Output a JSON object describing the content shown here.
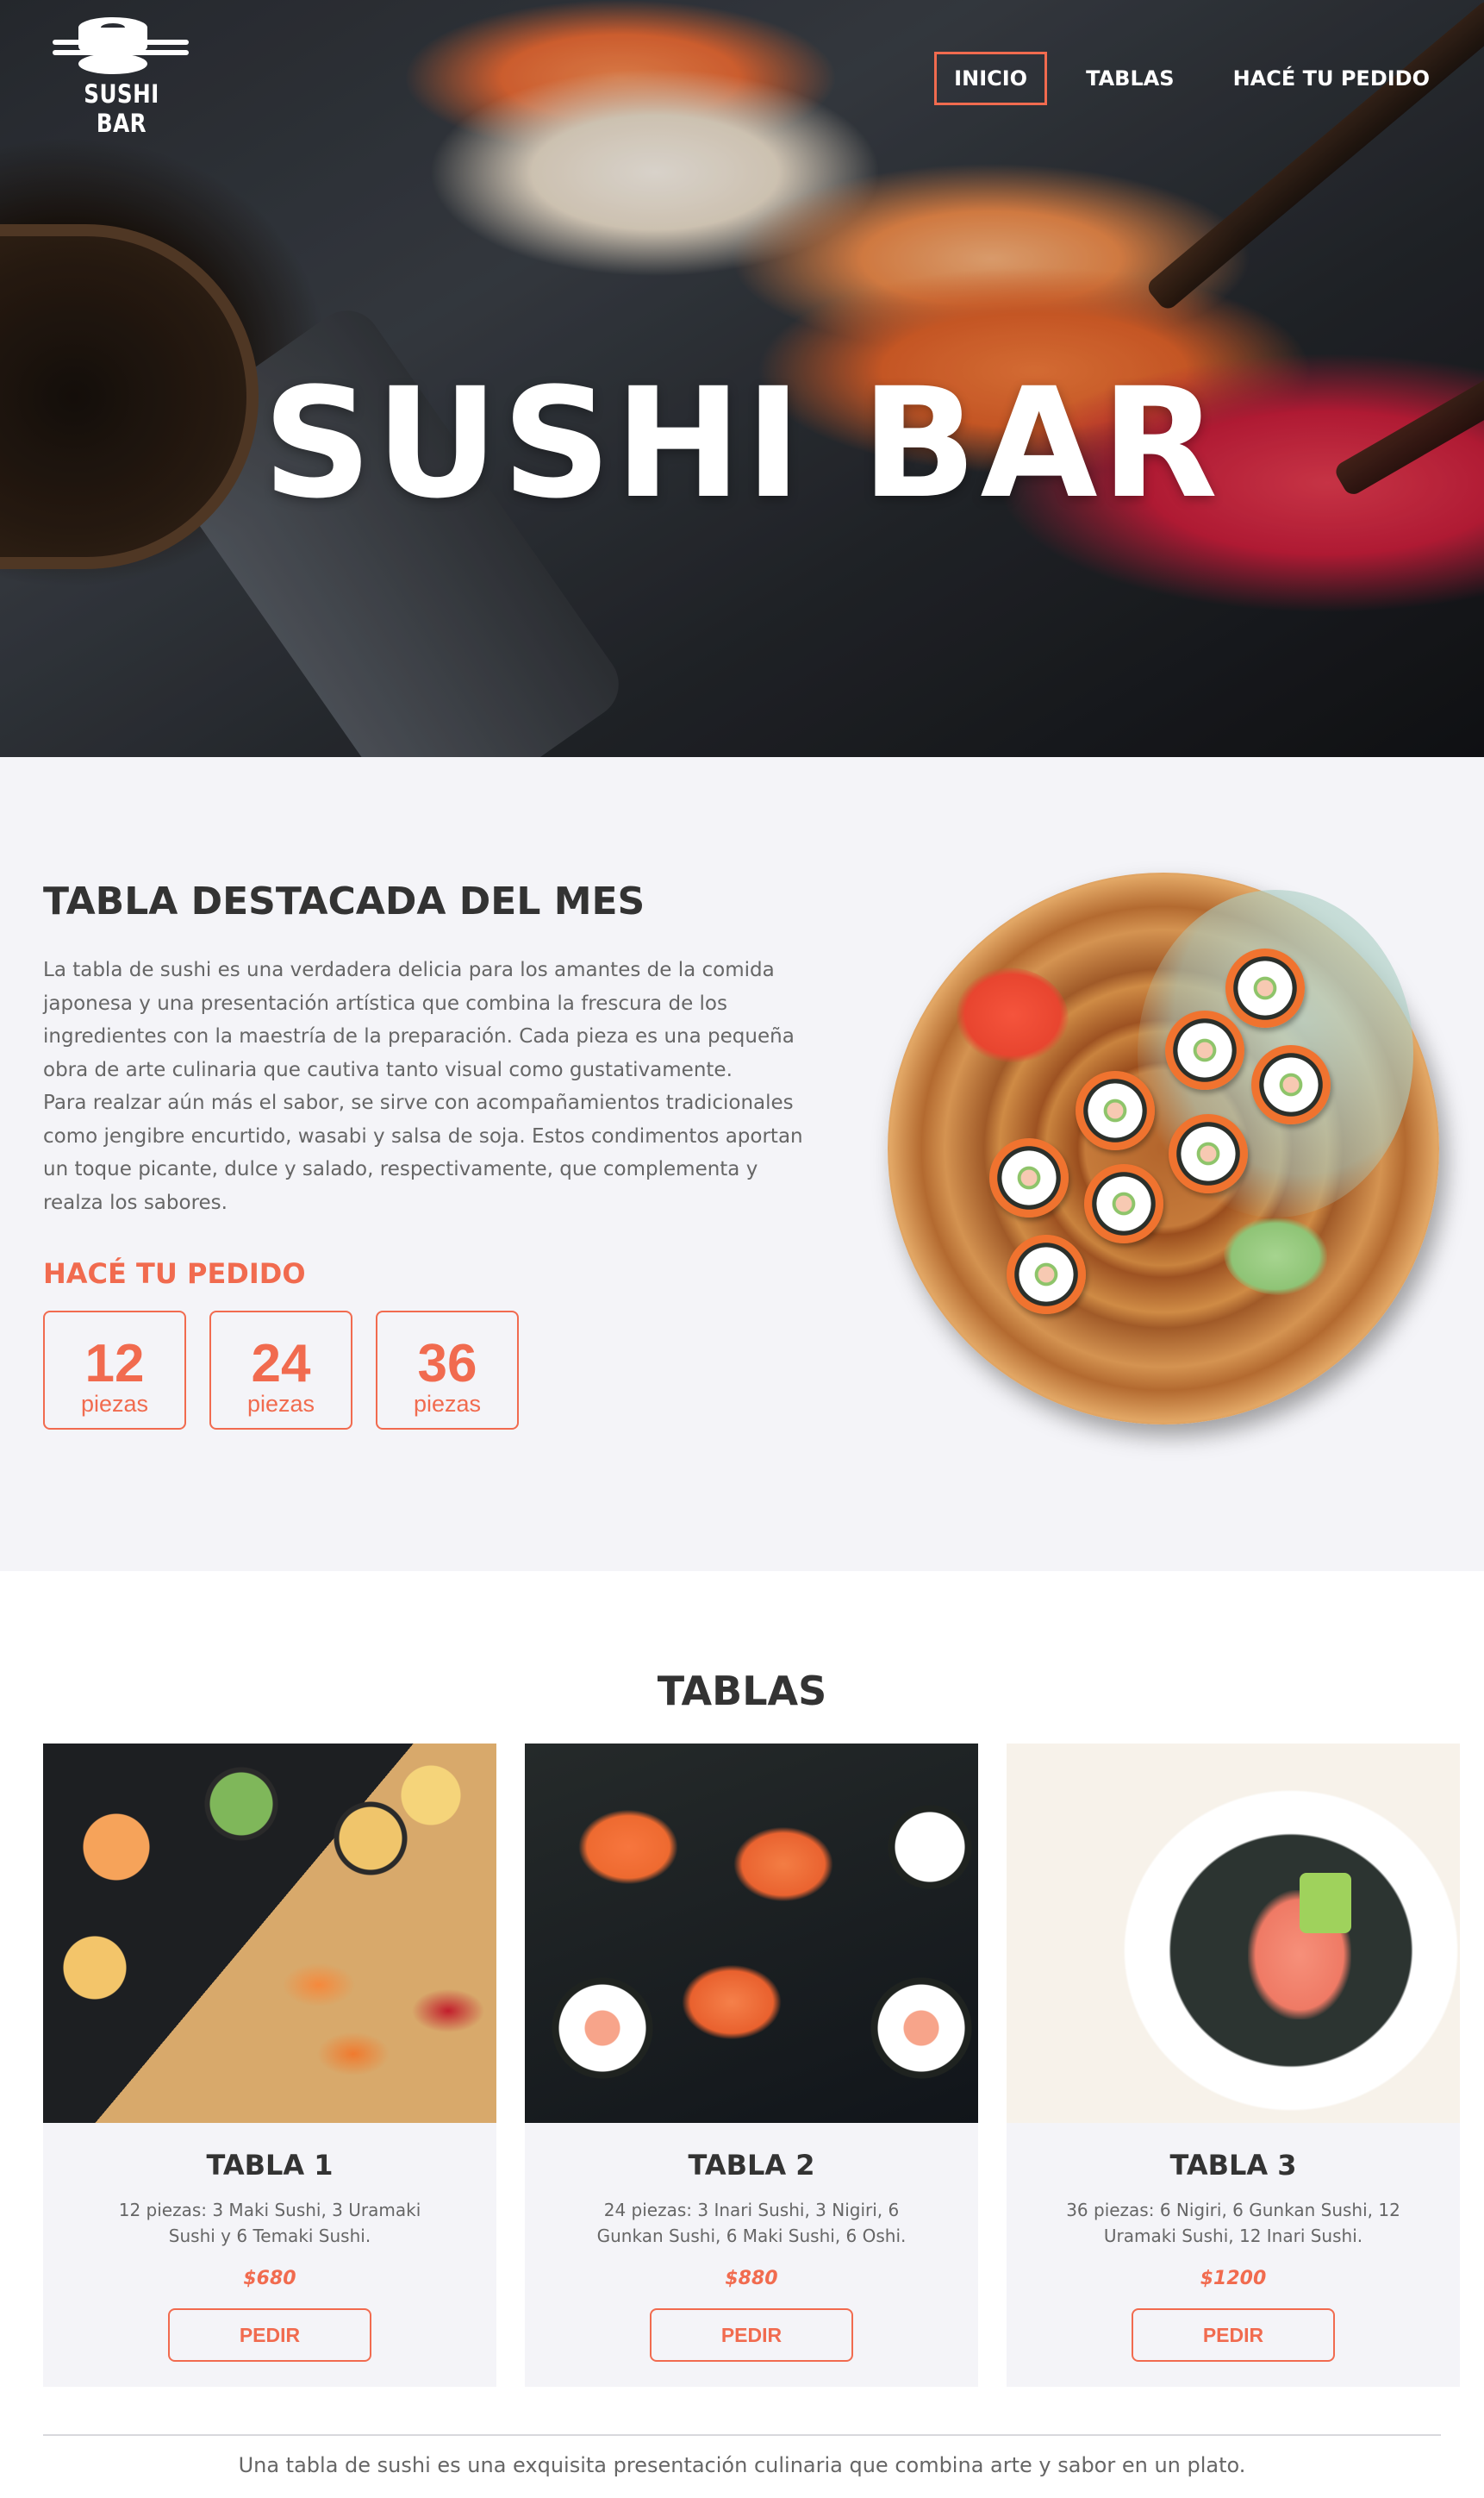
{
  "brand": {
    "logo_text": "SUSHI BAR"
  },
  "nav": {
    "items": [
      {
        "label": "INICIO",
        "active": true
      },
      {
        "label": "TABLAS",
        "active": false
      },
      {
        "label": "HACÉ TU PEDIDO",
        "active": false
      }
    ]
  },
  "hero": {
    "title": "SUSHI BAR"
  },
  "featured": {
    "title": "TABLA DESTACADA DEL MES",
    "paragraph1": "La tabla de sushi es una verdadera delicia para los amantes de la comida japonesa y una presentación artística que combina la frescura de los ingredientes con la maestría de la preparación. Cada pieza es una pequeña obra de arte culinaria que cautiva tanto visual como gustativamente.",
    "paragraph2": "Para realzar aún más el sabor, se sirve con acompañamientos tradicionales como jengibre encurtido, wasabi y salsa de soja. Estos condimentos aportan un toque picante, dulce y salado, respectivamente, que complementa y realza los sabores.",
    "order_title": "HACÉ TU PEDIDO",
    "options": [
      {
        "number": "12",
        "unit": "piezas"
      },
      {
        "number": "24",
        "unit": "piezas"
      },
      {
        "number": "36",
        "unit": "piezas"
      }
    ]
  },
  "tablas": {
    "title": "TABLAS",
    "cards": [
      {
        "title": "TABLA 1",
        "description": "12 piezas: 3 Maki Sushi, 3 Uramaki Sushi y 6 Temaki Sushi.",
        "price": "$680",
        "button": "PEDIR"
      },
      {
        "title": "TABLA 2",
        "description": "24 piezas: 3 Inari Sushi, 3 Nigiri, 6 Gunkan Sushi, 6 Maki Sushi, 6 Oshi.",
        "price": "$880",
        "button": "PEDIR"
      },
      {
        "title": "TABLA 3",
        "description": "36 piezas: 6 Nigiri, 6 Gunkan Sushi, 12 Uramaki Sushi, 12 Inari Sushi.",
        "price": "$1200",
        "button": "PEDIR"
      }
    ]
  },
  "footer": {
    "text": "Una tabla de sushi es una exquisita presentación culinaria que combina arte y sabor en un plato."
  },
  "colors": {
    "accent": "#f16b4f",
    "section_bg": "#f4f4f8",
    "text_dark": "#333333",
    "text_muted": "#666666"
  }
}
